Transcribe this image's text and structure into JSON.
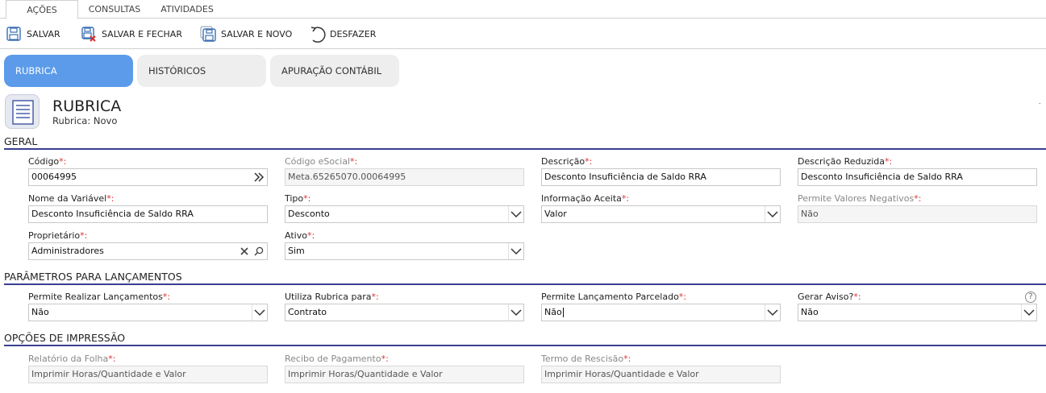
{
  "top_tabs": [
    {
      "label": "AÇÕES",
      "active": true
    },
    {
      "label": "CONSULTAS",
      "active": false
    },
    {
      "label": "ATIVIDADES",
      "active": false
    }
  ],
  "toolbar": {
    "save_label": "SALVAR",
    "save_close_label": "SALVAR E FECHAR",
    "save_new_label": "SALVAR E NOVO",
    "undo_label": "DESFAZER"
  },
  "page_tabs": [
    {
      "label": "RUBRICA",
      "active": true
    },
    {
      "label": "HISTÓRICOS",
      "active": false
    },
    {
      "label": "APURAÇÃO CONTÁBIL",
      "active": false
    }
  ],
  "header": {
    "title": "RUBRICA",
    "subtitle": "Rubrica: Novo",
    "corner_mark": "˙"
  },
  "sections": {
    "geral": "GERAL",
    "parametros": "PARÂMETROS PARA LANÇAMENTOS",
    "opcoes": "OPÇÕES DE IMPRESSÃO"
  },
  "geral": {
    "codigo": {
      "label": "Código",
      "value": "00064995"
    },
    "codigo_esocial": {
      "label": "Código eSocial",
      "value": "Meta.65265070.00064995"
    },
    "descricao": {
      "label": "Descrição",
      "value": "Desconto Insuficiência de Saldo RRA"
    },
    "descricao_reduzida": {
      "label": "Descrição Reduzida",
      "value": "Desconto Insuficiência de Saldo RRA"
    },
    "nome_variavel": {
      "label": "Nome da Variável",
      "value": "Desconto Insuficiência de Saldo RRA"
    },
    "tipo": {
      "label": "Tipo",
      "value": "Desconto"
    },
    "informacao_aceita": {
      "label": "Informação Aceita",
      "value": "Valor"
    },
    "permite_negativos": {
      "label": "Permite Valores Negativos",
      "value": "Não"
    },
    "proprietario": {
      "label": "Proprietário",
      "value": "Administradores"
    },
    "ativo": {
      "label": "Ativo",
      "value": "Sim"
    }
  },
  "parametros": {
    "permite_lancamentos": {
      "label": "Permite Realizar Lançamentos",
      "value": "Não"
    },
    "utiliza_rubrica": {
      "label": "Utiliza Rubrica para",
      "value": "Contrato"
    },
    "lancamento_parcelado": {
      "label": "Permite Lançamento Parcelado",
      "value": "Não"
    },
    "gerar_aviso": {
      "label": "Gerar Aviso?",
      "value": "Não"
    }
  },
  "opcoes": {
    "relatorio_folha": {
      "label": "Relatório da Folha",
      "value": "Imprimir Horas/Quantidade e Valor"
    },
    "recibo_pagamento": {
      "label": "Recibo de Pagamento",
      "value": "Imprimir Horas/Quantidade e Valor"
    },
    "termo_rescisao": {
      "label": "Termo de Rescisão",
      "value": "Imprimir Horas/Quantidade e Valor"
    }
  },
  "required_marker": "*:",
  "help_glyph": "?",
  "colors": {
    "accent_tab": "#5b9bea",
    "section_rule": "#3a3f8f",
    "required": "#dd3333"
  }
}
